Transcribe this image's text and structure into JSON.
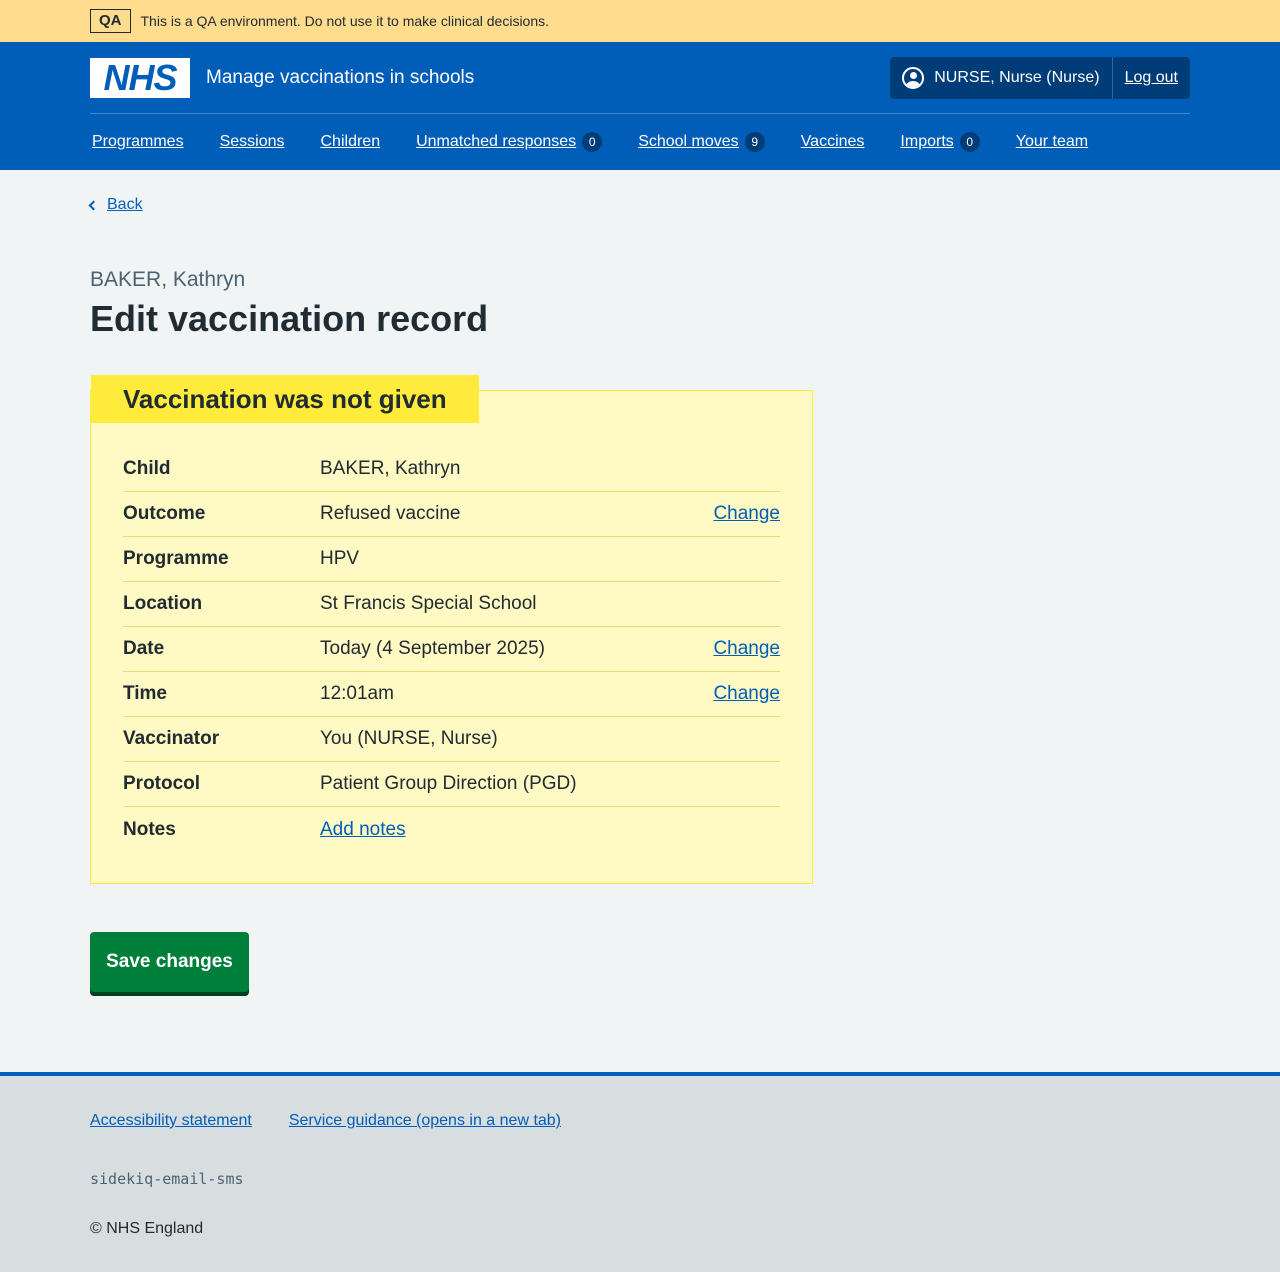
{
  "qa_banner": {
    "tag": "QA",
    "message": "This is a QA environment. Do not use it to make clinical decisions."
  },
  "header": {
    "logo_text": "NHS",
    "service_name": "Manage vaccinations in schools",
    "account": {
      "user": "NURSE, Nurse (Nurse)",
      "logout": "Log out"
    },
    "nav": [
      {
        "label": "Programmes"
      },
      {
        "label": "Sessions"
      },
      {
        "label": "Children"
      },
      {
        "label": "Unmatched responses",
        "count": "0"
      },
      {
        "label": "School moves",
        "count": "9"
      },
      {
        "label": "Vaccines"
      },
      {
        "label": "Imports",
        "count": "0"
      },
      {
        "label": "Your team"
      }
    ]
  },
  "main": {
    "back_label": "Back",
    "caption": "BAKER, Kathryn",
    "title": "Edit vaccination record",
    "card": {
      "heading": "Vaccination was not given",
      "rows": [
        {
          "key": "Child",
          "value": "BAKER, Kathryn",
          "action": ""
        },
        {
          "key": "Outcome",
          "value": "Refused vaccine",
          "action": "Change"
        },
        {
          "key": "Programme",
          "value": "HPV",
          "action": ""
        },
        {
          "key": "Location",
          "value": "St Francis Special School",
          "action": ""
        },
        {
          "key": "Date",
          "value": "Today (4 September 2025)",
          "action": "Change"
        },
        {
          "key": "Time",
          "value": "12:01am",
          "action": "Change"
        },
        {
          "key": "Vaccinator",
          "value": "You (NURSE, Nurse)",
          "action": ""
        },
        {
          "key": "Protocol",
          "value": "Patient Group Direction (PGD)",
          "action": ""
        },
        {
          "key": "Notes",
          "value": "Add notes",
          "action": ""
        }
      ]
    },
    "save_label": "Save changes"
  },
  "footer": {
    "links": [
      "Accessibility statement",
      "Service guidance (opens in a new tab)"
    ],
    "build": "sidekiq-email-sms",
    "copyright": "© NHS England"
  },
  "colors": {
    "nhs_blue": "#005eb8",
    "qa_banner": "#ffdc8e",
    "card_background": "#fff9c4",
    "card_heading": "#ffeb3b",
    "button_green": "#007f3b"
  }
}
